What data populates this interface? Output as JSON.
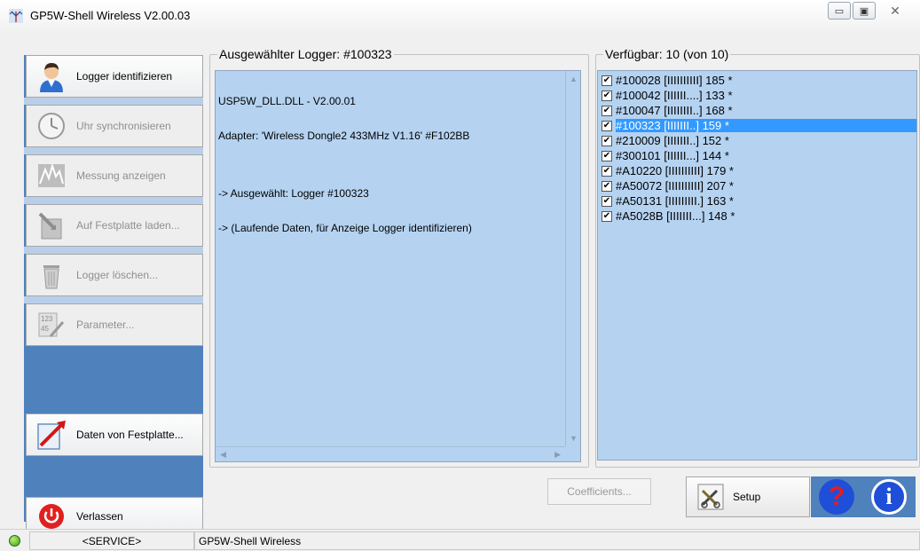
{
  "window": {
    "title": "GP5W-Shell Wireless V2.00.03",
    "minimize_glyph": "▭",
    "maximize_glyph": "▣",
    "close_glyph": "✕"
  },
  "sidebar": {
    "buttons": [
      {
        "label": "Logger identifizieren",
        "icon": "user-icon",
        "enabled": true
      },
      {
        "label": "Uhr synchronisieren",
        "icon": "clock-icon",
        "enabled": false
      },
      {
        "label": "Messung anzeigen",
        "icon": "measurement-icon",
        "enabled": false
      },
      {
        "label": "Auf Festplatte laden...",
        "icon": "download-to-disk-icon",
        "enabled": false
      },
      {
        "label": "Logger löschen...",
        "icon": "trash-icon",
        "enabled": false
      },
      {
        "label": "Parameter...",
        "icon": "parameter-icon",
        "enabled": false
      },
      {
        "label": "Daten von Festplatte...",
        "icon": "load-from-disk-icon",
        "enabled": true
      }
    ],
    "exit_label": "Verlassen"
  },
  "log_panel": {
    "title": "Ausgewählter Logger: #100323",
    "lines": [
      "USP5W_DLL.DLL - V2.00.01",
      "Adapter: 'Wireless Dongle2 433MHz V1.16' #F102BB",
      "",
      "-> Ausgewählt: Logger #100323",
      "-> (Laufende Daten, für Anzeige Logger identifizieren)"
    ]
  },
  "logger_list": {
    "title": "Verfügbar: 10 (von 10)",
    "items": [
      {
        "text": "#100028 [IIIIIIIIII] 185 *",
        "checked": true,
        "selected": false
      },
      {
        "text": "#100042 [IIIIII....] 133 *",
        "checked": true,
        "selected": false
      },
      {
        "text": "#100047 [IIIIIIII..] 168 *",
        "checked": true,
        "selected": false
      },
      {
        "text": "#100323 [IIIIIII..] 159 *",
        "checked": true,
        "selected": true
      },
      {
        "text": "#210009 [IIIIIII..] 152 *",
        "checked": true,
        "selected": false
      },
      {
        "text": "#300101 [IIIIII...] 144 *",
        "checked": true,
        "selected": false
      },
      {
        "text": "#A10220 [IIIIIIIIII] 179 *",
        "checked": true,
        "selected": false
      },
      {
        "text": "#A50072 [IIIIIIIIII] 207 *",
        "checked": true,
        "selected": false
      },
      {
        "text": "#A50131 [IIIIIIIII.] 163 *",
        "checked": true,
        "selected": false
      },
      {
        "text": "#A5028B [IIIIIII...] 148 *",
        "checked": true,
        "selected": false
      }
    ],
    "check_glyph": "✔"
  },
  "bottom": {
    "coefficients_label": "Coefficients...",
    "setup_label": "Setup",
    "help_glyph": "?",
    "info_glyph": "i"
  },
  "status": {
    "mode": "<SERVICE>",
    "app_name": "GP5W-Shell Wireless"
  },
  "colors": {
    "sidebar_blue": "#4f81bd",
    "panel_blue": "#b5d3f1",
    "selection": "#3399ff",
    "help_blue": "#1f4fd8",
    "help_red": "#e81c1c",
    "exit_red": "#e02020"
  }
}
